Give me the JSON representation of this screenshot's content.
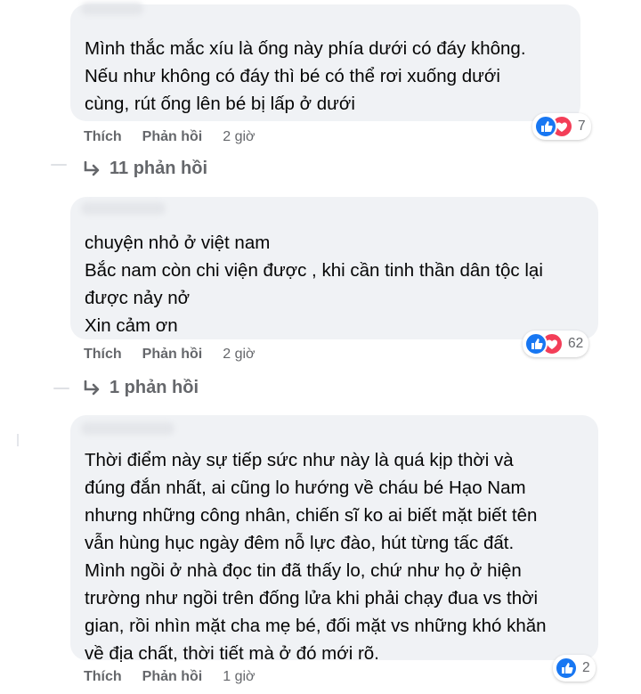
{
  "actions": {
    "like": "Thích",
    "reply": "Phản hồi"
  },
  "comments": [
    {
      "lines": [
        "Mình thắc mắc xíu là ống này phía dưới có đáy không.",
        "Nếu như không có đáy thì bé có thể rơi xuống dưới",
        "cùng, rút ống lên bé bị lấp ở dưới"
      ],
      "time": "2 giờ",
      "reaction_count": "7",
      "reactions": [
        "like",
        "love"
      ],
      "replies": "11 phản hồi"
    },
    {
      "lines": [
        "chuyện nhỏ ở việt nam",
        "Bắc nam còn chi viện được , khi cần tinh thần dân tộc lại",
        "được nảy nở",
        "Xin cảm ơn"
      ],
      "time": "2 giờ",
      "reaction_count": "62",
      "reactions": [
        "like",
        "love"
      ],
      "replies": "1 phản hồi"
    },
    {
      "lines": [
        "Thời điểm này sự tiếp sức như này là quá kịp thời và",
        "đúng đắn nhất, ai cũng lo hướng về cháu bé Hạo Nam",
        "nhưng những công nhân, chiến sĩ ko ai biết mặt biết tên",
        "vẫn hùng hục ngày đêm nỗ lực đào, hút từng tấc đất.",
        "Mình ngồi ở nhà đọc tin đã thấy lo, chứ như họ ở hiện",
        "trường như ngồi trên đống lửa khi phải chạy đua vs thời",
        "gian, rồi nhìn mặt cha mẹ bé, đối mặt vs những khó khăn",
        "về địa chất, thời tiết mà ở đó mới rõ."
      ],
      "time": "1 giờ",
      "reaction_count": "2",
      "reactions": [
        "like"
      ]
    }
  ],
  "colors": {
    "bubble": "#f0f2f5",
    "meta_text": "#65676b",
    "like_blue": "#1877f2",
    "love_red": "#f33e58"
  }
}
